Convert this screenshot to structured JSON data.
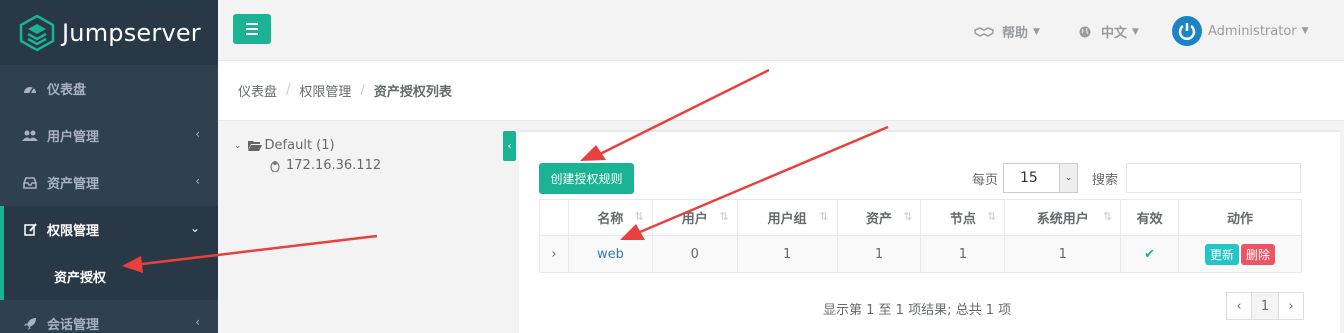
{
  "app": {
    "name": "Jumpserver",
    "logo_icon": "jumpserver-logo-icon"
  },
  "sidebar": {
    "items": [
      {
        "label": "仪表盘",
        "icon": "dashboard-icon",
        "has_children": false
      },
      {
        "label": "用户管理",
        "icon": "users-icon",
        "has_children": true
      },
      {
        "label": "资产管理",
        "icon": "inbox-icon",
        "has_children": true
      },
      {
        "label": "权限管理",
        "icon": "edit-icon",
        "has_children": true,
        "expanded": true
      },
      {
        "label": "会话管理",
        "icon": "rocket-icon",
        "has_children": true
      }
    ],
    "subitems": [
      {
        "label": "资产授权",
        "active": true
      }
    ]
  },
  "header": {
    "help_label": "帮助",
    "help_icon": "handshake-icon",
    "lang_label": "中文",
    "lang_icon": "globe-icon",
    "user_name": "Administrator",
    "avatar_icon": "power-avatar-icon"
  },
  "breadcrumb": [
    "仪表盘",
    "权限管理",
    "资产授权列表"
  ],
  "tree": {
    "root_label": "Default (1)",
    "root_icon": "folder-open-icon",
    "child_label": "172.16.36.112",
    "child_icon": "linux-icon"
  },
  "toolbar": {
    "create_label": "创建授权规则",
    "page_len_label": "每页",
    "page_len_value": "15",
    "search_label": "搜索",
    "search_value": ""
  },
  "table": {
    "columns": [
      "名称",
      "用户",
      "用户组",
      "资产",
      "节点",
      "系统用户",
      "有效",
      "动作"
    ],
    "rows": [
      {
        "name": "web",
        "users": "0",
        "user_groups": "1",
        "assets": "1",
        "nodes": "1",
        "system_users": "1",
        "valid": true,
        "update_label": "更新",
        "delete_label": "删除"
      }
    ]
  },
  "footer": {
    "info": "显示第 1 至 1 项结果; 总共 1 项",
    "prev": "‹",
    "page": "1",
    "next": "›"
  },
  "colors": {
    "sidebar_bg": "#2f4050",
    "accent": "#1ab394",
    "update_btn": "#23c6c8",
    "delete_btn": "#ed5565",
    "annotation_arrow": "#e8413d"
  }
}
